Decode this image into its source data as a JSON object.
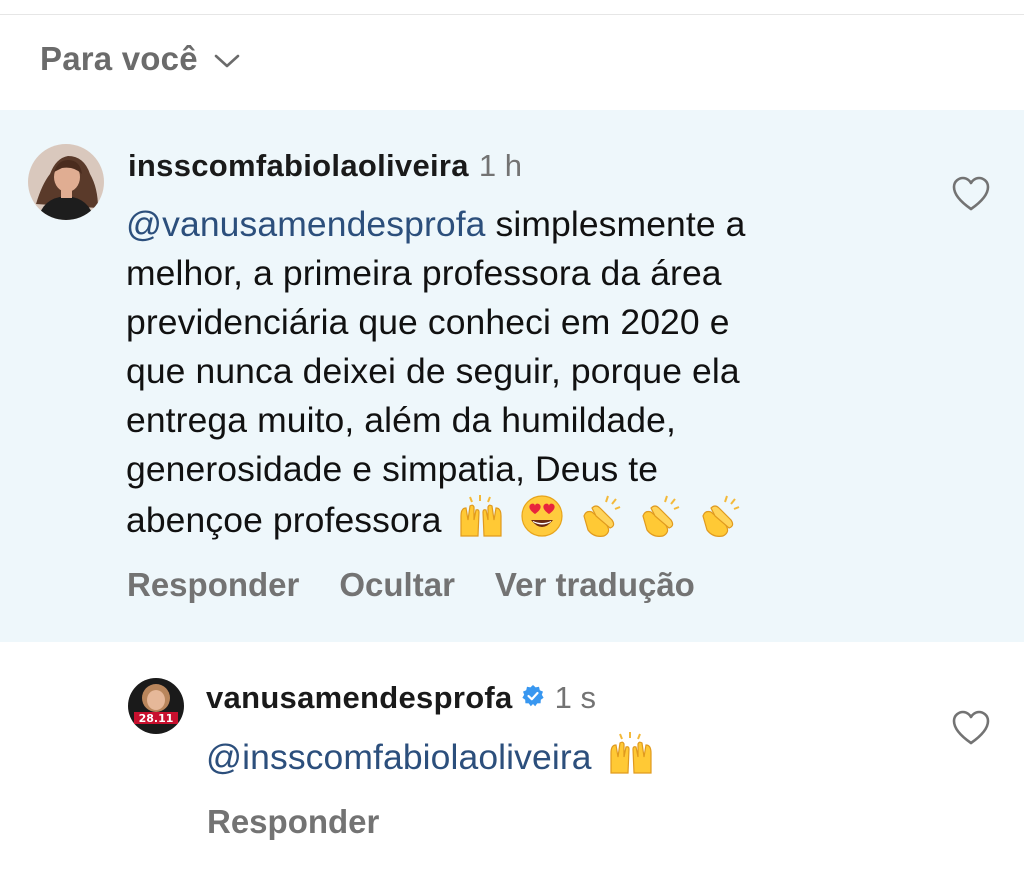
{
  "sort": {
    "label": "Para você"
  },
  "comments": [
    {
      "username": "insscomfabiolaoliveira",
      "time": "1 h",
      "mention": "@vanusamendesprofa",
      "lines": [
        " simplesmente a",
        "melhor, a primeira professora da área",
        "previdenciária que conheci em 2020 e",
        "que nunca deixei de seguir, porque ela",
        "entrega muito, além da humildade,",
        "generosidade e simpatia, Deus te",
        "abençoe professora"
      ],
      "emojis": [
        "raising-hands",
        "heart-eyes",
        "clapping-hands",
        "clapping-hands",
        "clapping-hands"
      ],
      "actions": {
        "reply": "Responder",
        "hide": "Ocultar",
        "translate": "Ver tradução"
      },
      "highlight_color": "#eef7fb"
    },
    {
      "username": "vanusamendesprofa",
      "verified": true,
      "time": "1 s",
      "mention": "@insscomfabiolaoliveira",
      "emojis": [
        "raising-hands"
      ],
      "actions": {
        "reply": "Responder"
      },
      "avatar_badge": "28.11"
    }
  ],
  "colors": {
    "mention": "#2c4f7c",
    "muted": "#737373",
    "verified": "#3897f0"
  }
}
